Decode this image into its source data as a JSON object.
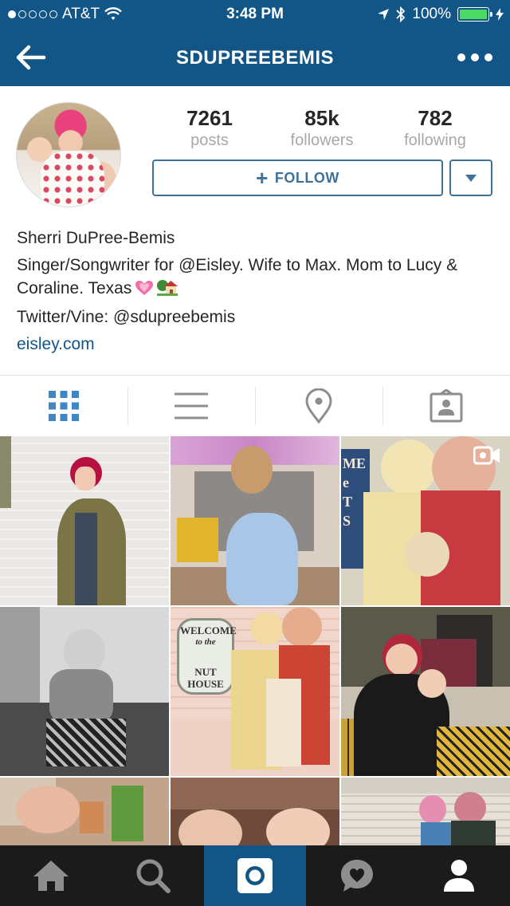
{
  "status_bar": {
    "carrier": "AT&T",
    "time": "3:48 PM",
    "battery": "100%",
    "signal_bars_filled": 1,
    "signal_bars_total": 5
  },
  "header": {
    "title": "SDUPREEBEMIS",
    "back_icon": "back-arrow-icon",
    "more_icon": "more-options-icon",
    "background_color": "#125688"
  },
  "profile": {
    "stats": [
      {
        "value": "7261",
        "label": "posts"
      },
      {
        "value": "85k",
        "label": "followers"
      },
      {
        "value": "782",
        "label": "following"
      }
    ],
    "follow_button": {
      "icon": "+",
      "label": "FOLLOW"
    },
    "name": "Sherri DuPree-Bemis",
    "bio": "Singer/Songwriter for @Eisley. Wife to Max. Mom to Lucy & Coraline. Texas",
    "bio_emoji": [
      "growing-heart-icon",
      "house-with-garden-icon"
    ],
    "twitter": "Twitter/Vine: @sdupreebemis",
    "website": "eisley.com",
    "accent_color": "#3f729b",
    "link_color": "#125688"
  },
  "view_tabs": [
    {
      "name": "grid-view",
      "active": true
    },
    {
      "name": "list-view",
      "active": false
    },
    {
      "name": "map-view",
      "active": false
    },
    {
      "name": "tagged-view",
      "active": false
    }
  ],
  "photo_signs": {
    "sign_top_right": "ME\ne\nT\nS",
    "welcome_line1": "WELCOME",
    "welcome_line2": "to the",
    "welcome_line3": "NUT",
    "welcome_line4": "HOUSE"
  },
  "bottom_tabs": [
    {
      "name": "home",
      "active": false
    },
    {
      "name": "search",
      "active": false
    },
    {
      "name": "camera",
      "active": true
    },
    {
      "name": "activity",
      "active": false
    },
    {
      "name": "profile",
      "active": false
    }
  ]
}
